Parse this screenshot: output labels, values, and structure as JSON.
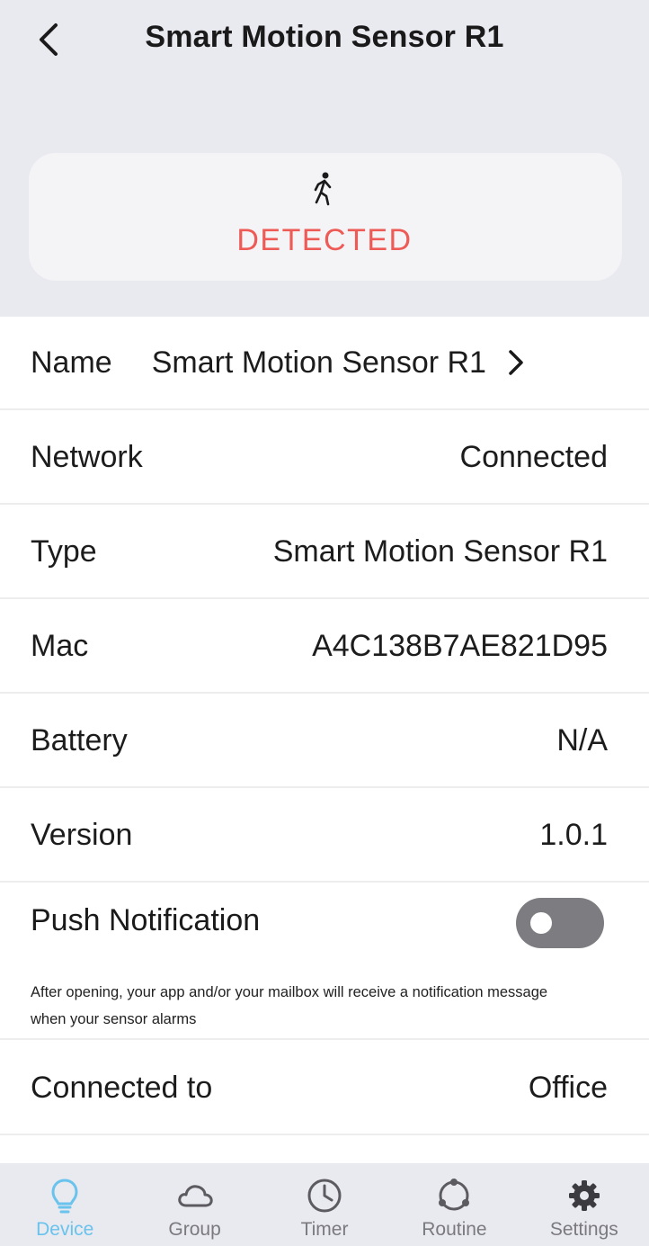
{
  "header": {
    "title": "Smart Motion Sensor R1",
    "back_icon": "chevron-left-icon"
  },
  "status": {
    "icon": "walking-person-icon",
    "text": "DETECTED",
    "color": "#ee5a55"
  },
  "details": {
    "name": {
      "label": "Name",
      "value": "Smart Motion Sensor R1"
    },
    "network": {
      "label": "Network",
      "value": "Connected"
    },
    "type": {
      "label": "Type",
      "value": "Smart Motion Sensor R1"
    },
    "mac": {
      "label": "Mac",
      "value": "A4C138B7AE821D95"
    },
    "battery": {
      "label": "Battery",
      "value": "N/A"
    },
    "version": {
      "label": "Version",
      "value": "1.0.1"
    },
    "connected_to": {
      "label": "Connected to",
      "value": "Office"
    }
  },
  "push_notification": {
    "label": "Push Notification",
    "enabled": false,
    "description": "After opening, your app and/or your mailbox will receive a notification message when your sensor alarms"
  },
  "tabbar": {
    "active_color": "#69c3ec",
    "items": [
      {
        "label": "Device",
        "icon": "lightbulb-icon",
        "active": true
      },
      {
        "label": "Group",
        "icon": "cloud-icon",
        "active": false
      },
      {
        "label": "Timer",
        "icon": "clock-icon",
        "active": false
      },
      {
        "label": "Routine",
        "icon": "routine-cycle-icon",
        "active": false
      },
      {
        "label": "Settings",
        "icon": "gear-icon",
        "active": false
      }
    ]
  }
}
